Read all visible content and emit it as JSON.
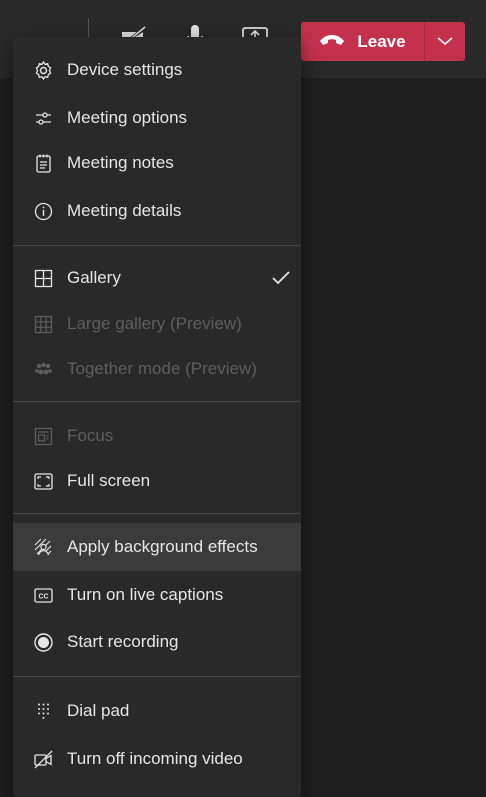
{
  "toolbar": {
    "leave_label": "Leave"
  },
  "menu": {
    "groups": [
      {
        "items": [
          {
            "label": "Device settings",
            "icon": "gear-icon",
            "enabled": true
          },
          {
            "label": "Meeting options",
            "icon": "sliders-icon",
            "enabled": true
          },
          {
            "label": "Meeting notes",
            "icon": "notes-icon",
            "enabled": true
          },
          {
            "label": "Meeting details",
            "icon": "info-icon",
            "enabled": true
          }
        ]
      },
      {
        "items": [
          {
            "label": "Gallery",
            "icon": "gallery-icon",
            "enabled": true,
            "checked": true
          },
          {
            "label": "Large gallery (Preview)",
            "icon": "large-gallery-icon",
            "enabled": false
          },
          {
            "label": "Together mode (Preview)",
            "icon": "together-mode-icon",
            "enabled": false
          }
        ]
      },
      {
        "items": [
          {
            "label": "Focus",
            "icon": "focus-icon",
            "enabled": false
          },
          {
            "label": "Full screen",
            "icon": "fullscreen-icon",
            "enabled": true
          }
        ]
      },
      {
        "items": [
          {
            "label": "Apply background effects",
            "icon": "background-effects-icon",
            "enabled": true,
            "hovered": true
          },
          {
            "label": "Turn on live captions",
            "icon": "captions-icon",
            "enabled": true
          },
          {
            "label": "Start recording",
            "icon": "record-icon",
            "enabled": true
          }
        ]
      },
      {
        "items": [
          {
            "label": "Dial pad",
            "icon": "dialpad-icon",
            "enabled": true
          },
          {
            "label": "Turn off incoming video",
            "icon": "video-off-icon",
            "enabled": true
          }
        ]
      }
    ]
  },
  "colors": {
    "leave_button": "#c4314b",
    "menu_background": "#292929",
    "hover_background": "#3b3b3b",
    "text_enabled": "#e6e6e6",
    "text_disabled": "#5e5e5e"
  }
}
